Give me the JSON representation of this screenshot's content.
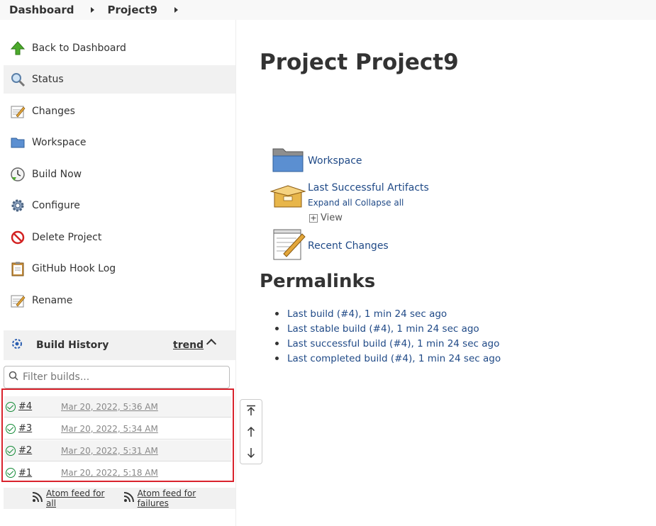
{
  "breadcrumb": {
    "items": [
      "Dashboard",
      "Project9"
    ]
  },
  "sidebar": {
    "items": [
      {
        "label": "Back to Dashboard",
        "icon": "up-arrow-icon"
      },
      {
        "label": "Status",
        "icon": "magnifier-icon"
      },
      {
        "label": "Changes",
        "icon": "notepad-icon"
      },
      {
        "label": "Workspace",
        "icon": "folder-icon"
      },
      {
        "label": "Build Now",
        "icon": "clock-icon"
      },
      {
        "label": "Configure",
        "icon": "gear-icon"
      },
      {
        "label": "Delete Project",
        "icon": "no-entry-icon"
      },
      {
        "label": "GitHub Hook Log",
        "icon": "clipboard-icon"
      },
      {
        "label": "Rename",
        "icon": "notepad-icon"
      }
    ]
  },
  "build_history": {
    "title": "Build History",
    "trend_label": "trend",
    "filter_placeholder": "Filter builds...",
    "builds": [
      {
        "number": "#4",
        "date": "Mar 20, 2022, 5:36 AM"
      },
      {
        "number": "#3",
        "date": "Mar 20, 2022, 5:34 AM"
      },
      {
        "number": "#2",
        "date": "Mar 20, 2022, 5:31 AM"
      },
      {
        "number": "#1",
        "date": "Mar 20, 2022, 5:18 AM"
      }
    ],
    "feed_all": "Atom feed for all",
    "feed_failures": "Atom feed for failures"
  },
  "main": {
    "title": "Project Project9",
    "workspace": "Workspace",
    "artifacts": "Last Successful Artifacts",
    "expand_all": "Expand all",
    "collapse_all": "Collapse all",
    "view": "View",
    "recent_changes": "Recent Changes",
    "permalinks_title": "Permalinks",
    "permalinks": [
      "Last build (#4), 1 min 24 sec ago",
      "Last stable build (#4), 1 min 24 sec ago",
      "Last successful build (#4), 1 min 24 sec ago",
      "Last completed build (#4), 1 min 24 sec ago"
    ]
  },
  "colors": {
    "link": "#204a87",
    "highlight": "#d9232d",
    "success": "#138a36"
  }
}
